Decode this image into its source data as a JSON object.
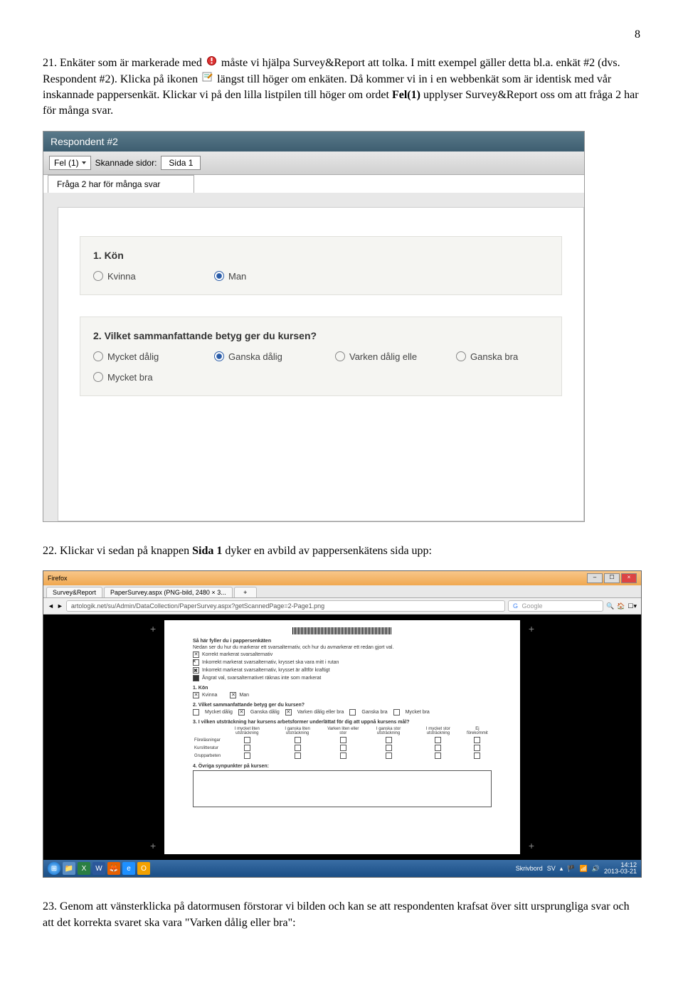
{
  "page_number": "8",
  "para21_a": "21. Enkäter som är markerade med ",
  "para21_b": " måste vi hjälpa Survey&Report att tolka. I mitt exempel gäller detta bl.a. enkät #2 (dvs. Respondent #2). Klicka på ikonen ",
  "para21_c": " längst till höger om enkäten. Då kommer vi in i en webbenkät som är identisk med vår inskannade pappersenkät. Klickar vi på den lilla listpilen till höger om ordet ",
  "para21_bold": "Fel(1)",
  "para21_d": " upplyser Survey&Report oss om att fråga 2 har för många svar.",
  "ss1": {
    "header": "Respondent #2",
    "fel_label": "Fel (1)",
    "sidor_label": "Skannade sidor:",
    "sida_btn": "Sida 1",
    "error_msg": "Fråga 2 har för många svar",
    "q1": {
      "title": "1. Kön",
      "opts": [
        "Kvinna",
        "Man"
      ],
      "selected": 1
    },
    "q2": {
      "title": "2. Vilket sammanfattande betyg ger du kursen?",
      "opts": [
        "Mycket dålig",
        "Ganska dålig",
        "Varken dålig elle",
        "Ganska bra",
        "Mycket bra"
      ],
      "selected": 1
    }
  },
  "para22_a": "22. Klickar vi sedan på knappen ",
  "para22_bold": "Sida 1",
  "para22_b": " dyker en avbild av pappersenkätens sida upp:",
  "ss2": {
    "firefox": "Firefox",
    "tab1": "Survey&Report",
    "tab2": "PaperSurvey.aspx (PNG-bild, 2480 × 3...",
    "url": "artologik.net/su/Admin/DataCollection/PaperSurvey.aspx?getScannedPage=2-Page1.png",
    "search": "Google",
    "paper": {
      "instr_title": "Så här fyller du i pappersenkäten",
      "instr_sub": "Nedan ser du hur du markerar ett svarsalternativ, och hur du avmarkerar ett redan gjort val.",
      "instr1": "Korrekt markerat svarsalternativ",
      "instr2": "Inkorrekt markerat svarsalternativ, krysset ska vara mitt i rutan",
      "instr3": "Inkorrekt markerat svarsalternativ, krysset är alltför kraftigt",
      "instr4": "Ångrat val, svarsalternativet räknas inte som markerat",
      "q1_title": "1. Kön",
      "q1_opts": [
        "Kvinna",
        "Man"
      ],
      "q2_title": "2. Vilket sammanfattande betyg ger du kursen?",
      "q2_opts": [
        "Mycket dålig",
        "Ganska dålig",
        "Varken dålig eller bra",
        "Ganska bra",
        "Mycket bra"
      ],
      "q3_title": "3. I vilken utsträckning har kursens arbetsformer underlättat för dig att uppnå kursens mål?",
      "q3_cols": [
        "I mycket liten utsträckning",
        "I ganska liten utsträckning",
        "Varken liten eller stor",
        "I ganska stor utsträckning",
        "I mycket stor utsträckning",
        "Ej förekommit"
      ],
      "q3_rows": [
        "Föreläsningar",
        "Kurslitteratur",
        "Grupparbeten"
      ],
      "q4_title": "4. Övriga synpunkter på kursen:"
    },
    "taskbar": {
      "lang": "SV",
      "time": "14:12",
      "date": "2013-03-21",
      "skrivbord": "Skrivbord"
    }
  },
  "para23": "23. Genom att vänsterklicka på datormusen förstorar vi bilden och kan se att respondenten krafsat över sitt ursprungliga svar och att det korrekta svaret ska vara \"Varken dålig eller bra\":"
}
